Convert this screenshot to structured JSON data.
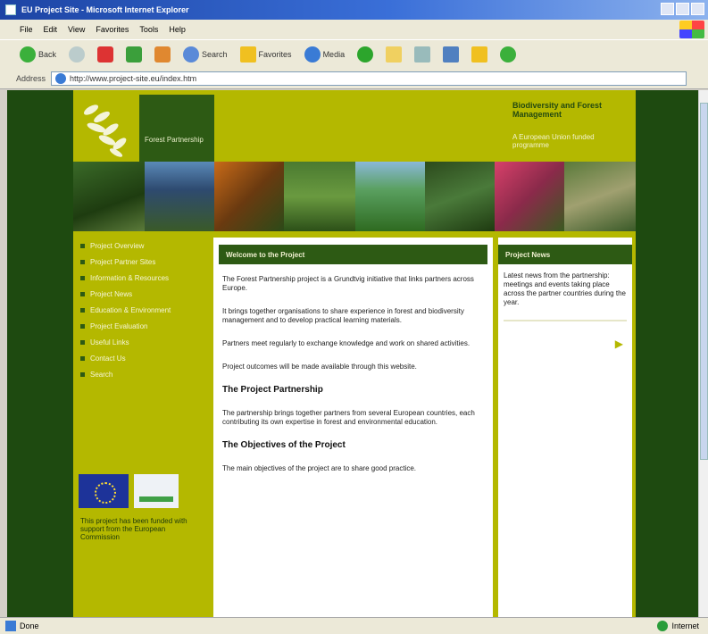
{
  "browser": {
    "title": "EU Project Site - Microsoft Internet Explorer",
    "menu": [
      "File",
      "Edit",
      "View",
      "Favorites",
      "Tools",
      "Help"
    ],
    "toolbar": {
      "back": "Back",
      "search": "Search",
      "favorites": "Favorites",
      "media": "Media"
    },
    "address": {
      "label": "Address",
      "url": "http://www.project-site.eu/index.htm"
    },
    "status": {
      "text": "Done",
      "zone": "Internet"
    }
  },
  "site": {
    "org_name": "Forest Partnership",
    "tagline": "Biodiversity and Forest Management",
    "subtag": "A European Union funded programme",
    "nav": [
      "Project Overview",
      "Project Partner Sites",
      "Information & Resources",
      "Project News",
      "Education & Environment",
      "Project Evaluation",
      "Useful Links",
      "Contact Us",
      "Search"
    ],
    "logos_caption": "This project has been funded with support from the European Commission",
    "main": {
      "heading": "Welcome to the Project",
      "p1": "The Forest Partnership project is a Grundtvig initiative that links partners across Europe.",
      "p2": "It brings together organisations to share experience in forest and biodiversity management and to develop practical learning materials.",
      "p3": "Partners meet regularly to exchange knowledge and work on shared activities.",
      "p4": "Project outcomes will be made available through this website.",
      "h_partnership": "The Project Partnership",
      "p5": "The partnership brings together partners from several European countries, each contributing its own expertise in forest and environmental education.",
      "h_objectives": "The Objectives of the Project",
      "p6": "The main objectives of the project are to share good practice."
    },
    "news": {
      "heading": "Project News",
      "text": "Latest news from the partnership: meetings and events taking place across the partner countries during the year."
    }
  },
  "colors": {
    "dark_green": "#1e4a10",
    "olive": "#b4b800",
    "mid_green": "#2d5a14"
  }
}
